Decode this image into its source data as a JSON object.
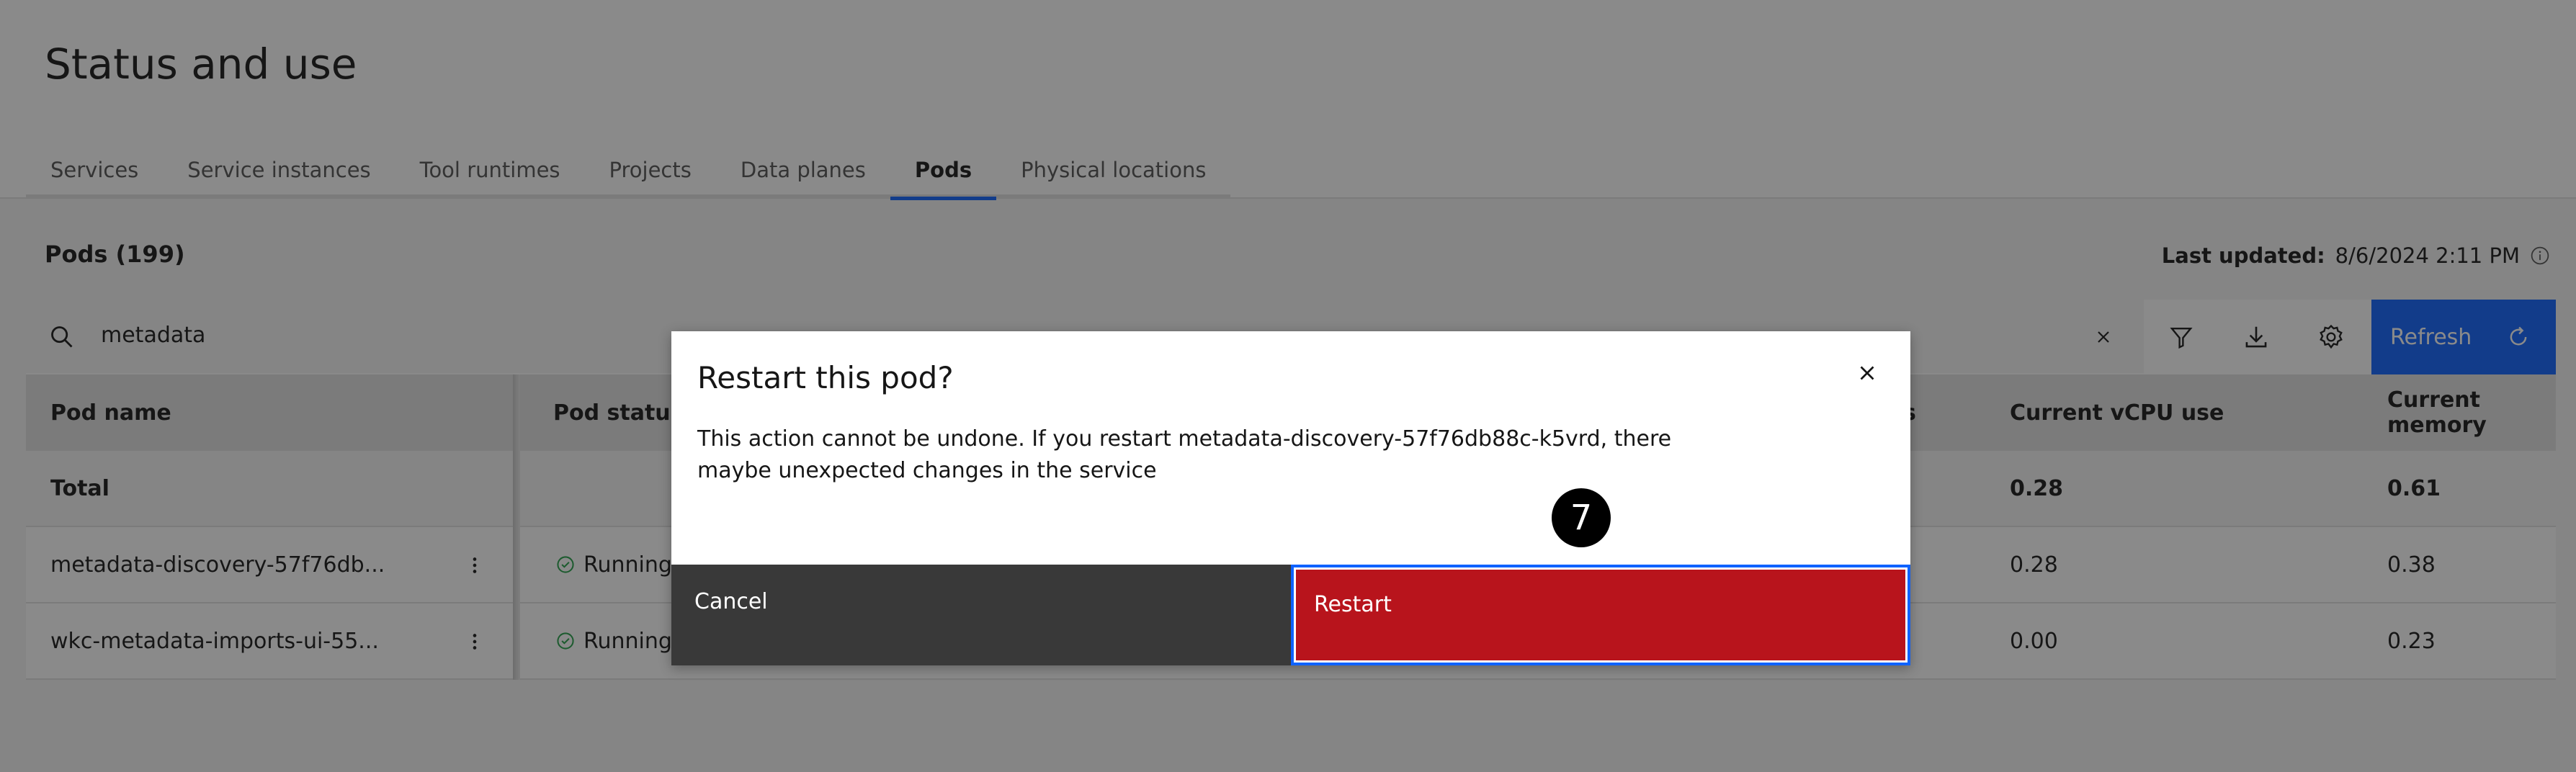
{
  "page": {
    "title": "Status and use"
  },
  "tabs": [
    {
      "label": "Services"
    },
    {
      "label": "Service instances"
    },
    {
      "label": "Tool runtimes"
    },
    {
      "label": "Projects"
    },
    {
      "label": "Data planes"
    },
    {
      "label": "Pods",
      "selected": true
    },
    {
      "label": "Physical locations"
    }
  ],
  "section": {
    "title": "Pods (199)",
    "last_updated_label": "Last updated:",
    "last_updated_value": "8/6/2024 2:11 PM"
  },
  "toolbar": {
    "search_value": "metadata",
    "refresh_label": "Refresh",
    "icons": [
      "search-icon",
      "clear-icon",
      "filter-icon",
      "download-icon",
      "settings-icon",
      "refresh-icon"
    ]
  },
  "table": {
    "headers": {
      "pod_name": "Pod name",
      "pod_status": "Pod status",
      "hidden_partial": "s",
      "cpu": "Current vCPU use",
      "memory": "Current memory"
    },
    "total": {
      "label": "Total",
      "cpu": "0.28",
      "memory": "0.61"
    },
    "rows": [
      {
        "name": "metadata-discovery-57f76db...",
        "status": "Running",
        "cpu": "0.28",
        "memory": "0.38"
      },
      {
        "name": "wkc-metadata-imports-ui-55...",
        "status": "Running",
        "cpu": "0.00",
        "memory": "0.23"
      }
    ]
  },
  "modal": {
    "title": "Restart this pod?",
    "body": "This action cannot be undone. If you restart metadata-discovery-57f76db88c-k5vrd, there maybe unexpected changes in the service",
    "cancel_label": "Cancel",
    "restart_label": "Restart"
  },
  "annotation": {
    "step_number": "7"
  },
  "colors": {
    "accent": "#0f62fe",
    "danger": "#b8141c",
    "secondary_button": "#393939",
    "success": "#24a148"
  }
}
